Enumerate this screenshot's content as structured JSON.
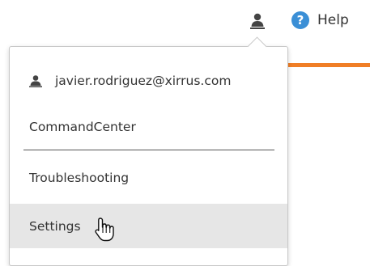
{
  "header": {
    "user_icon": "user-icon",
    "help_icon": "help-question-icon",
    "help_icon_glyph": "?",
    "help_label": "Help",
    "accent_color": "#f07e26",
    "help_color": "#3b8fd6"
  },
  "dropdown": {
    "email": "javier.rodriguez@xirrus.com",
    "items": [
      {
        "label": "CommandCenter"
      },
      {
        "label": "Troubleshooting"
      },
      {
        "label": "Settings",
        "hovered": true
      }
    ],
    "hover_background": "#e6e6e6"
  }
}
